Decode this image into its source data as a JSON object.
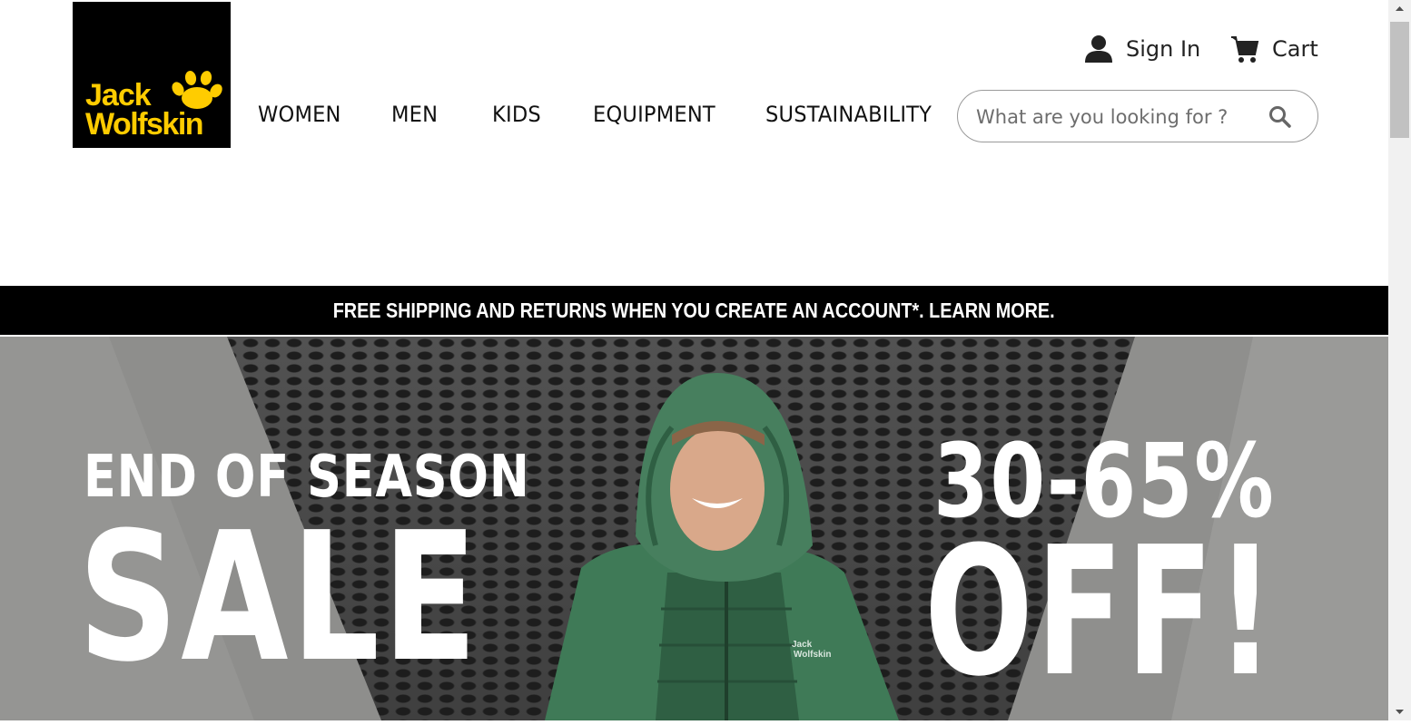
{
  "brand": {
    "logo_line1": "Jack",
    "logo_line2": "Wolfskin",
    "logo_icon": "paw-print-icon",
    "logo_bg": "#000000",
    "logo_fg": "#ffcc00"
  },
  "nav": {
    "items": [
      {
        "label": "WOMEN"
      },
      {
        "label": "MEN"
      },
      {
        "label": "KIDS"
      },
      {
        "label": "EQUIPMENT"
      },
      {
        "label": "SUSTAINABILITY"
      }
    ]
  },
  "account": {
    "sign_in_label": "Sign In",
    "sign_in_icon": "user-icon",
    "cart_label": "Cart",
    "cart_icon": "cart-icon"
  },
  "search": {
    "placeholder": "What are you looking for ?",
    "value": "",
    "icon": "search-icon"
  },
  "promo": {
    "text": "FREE SHIPPING AND RETURNS WHEN YOU CREATE AN ACCOUNT*. LEARN MORE."
  },
  "hero": {
    "line1": "END OF SEASON",
    "line2": "SALE",
    "discount": "30-65%",
    "discount_suffix": "OFF!",
    "jacket_logo_line1": "Jack",
    "jacket_logo_line2": "Wolfskin",
    "jacket_color": "#3f7a57"
  }
}
